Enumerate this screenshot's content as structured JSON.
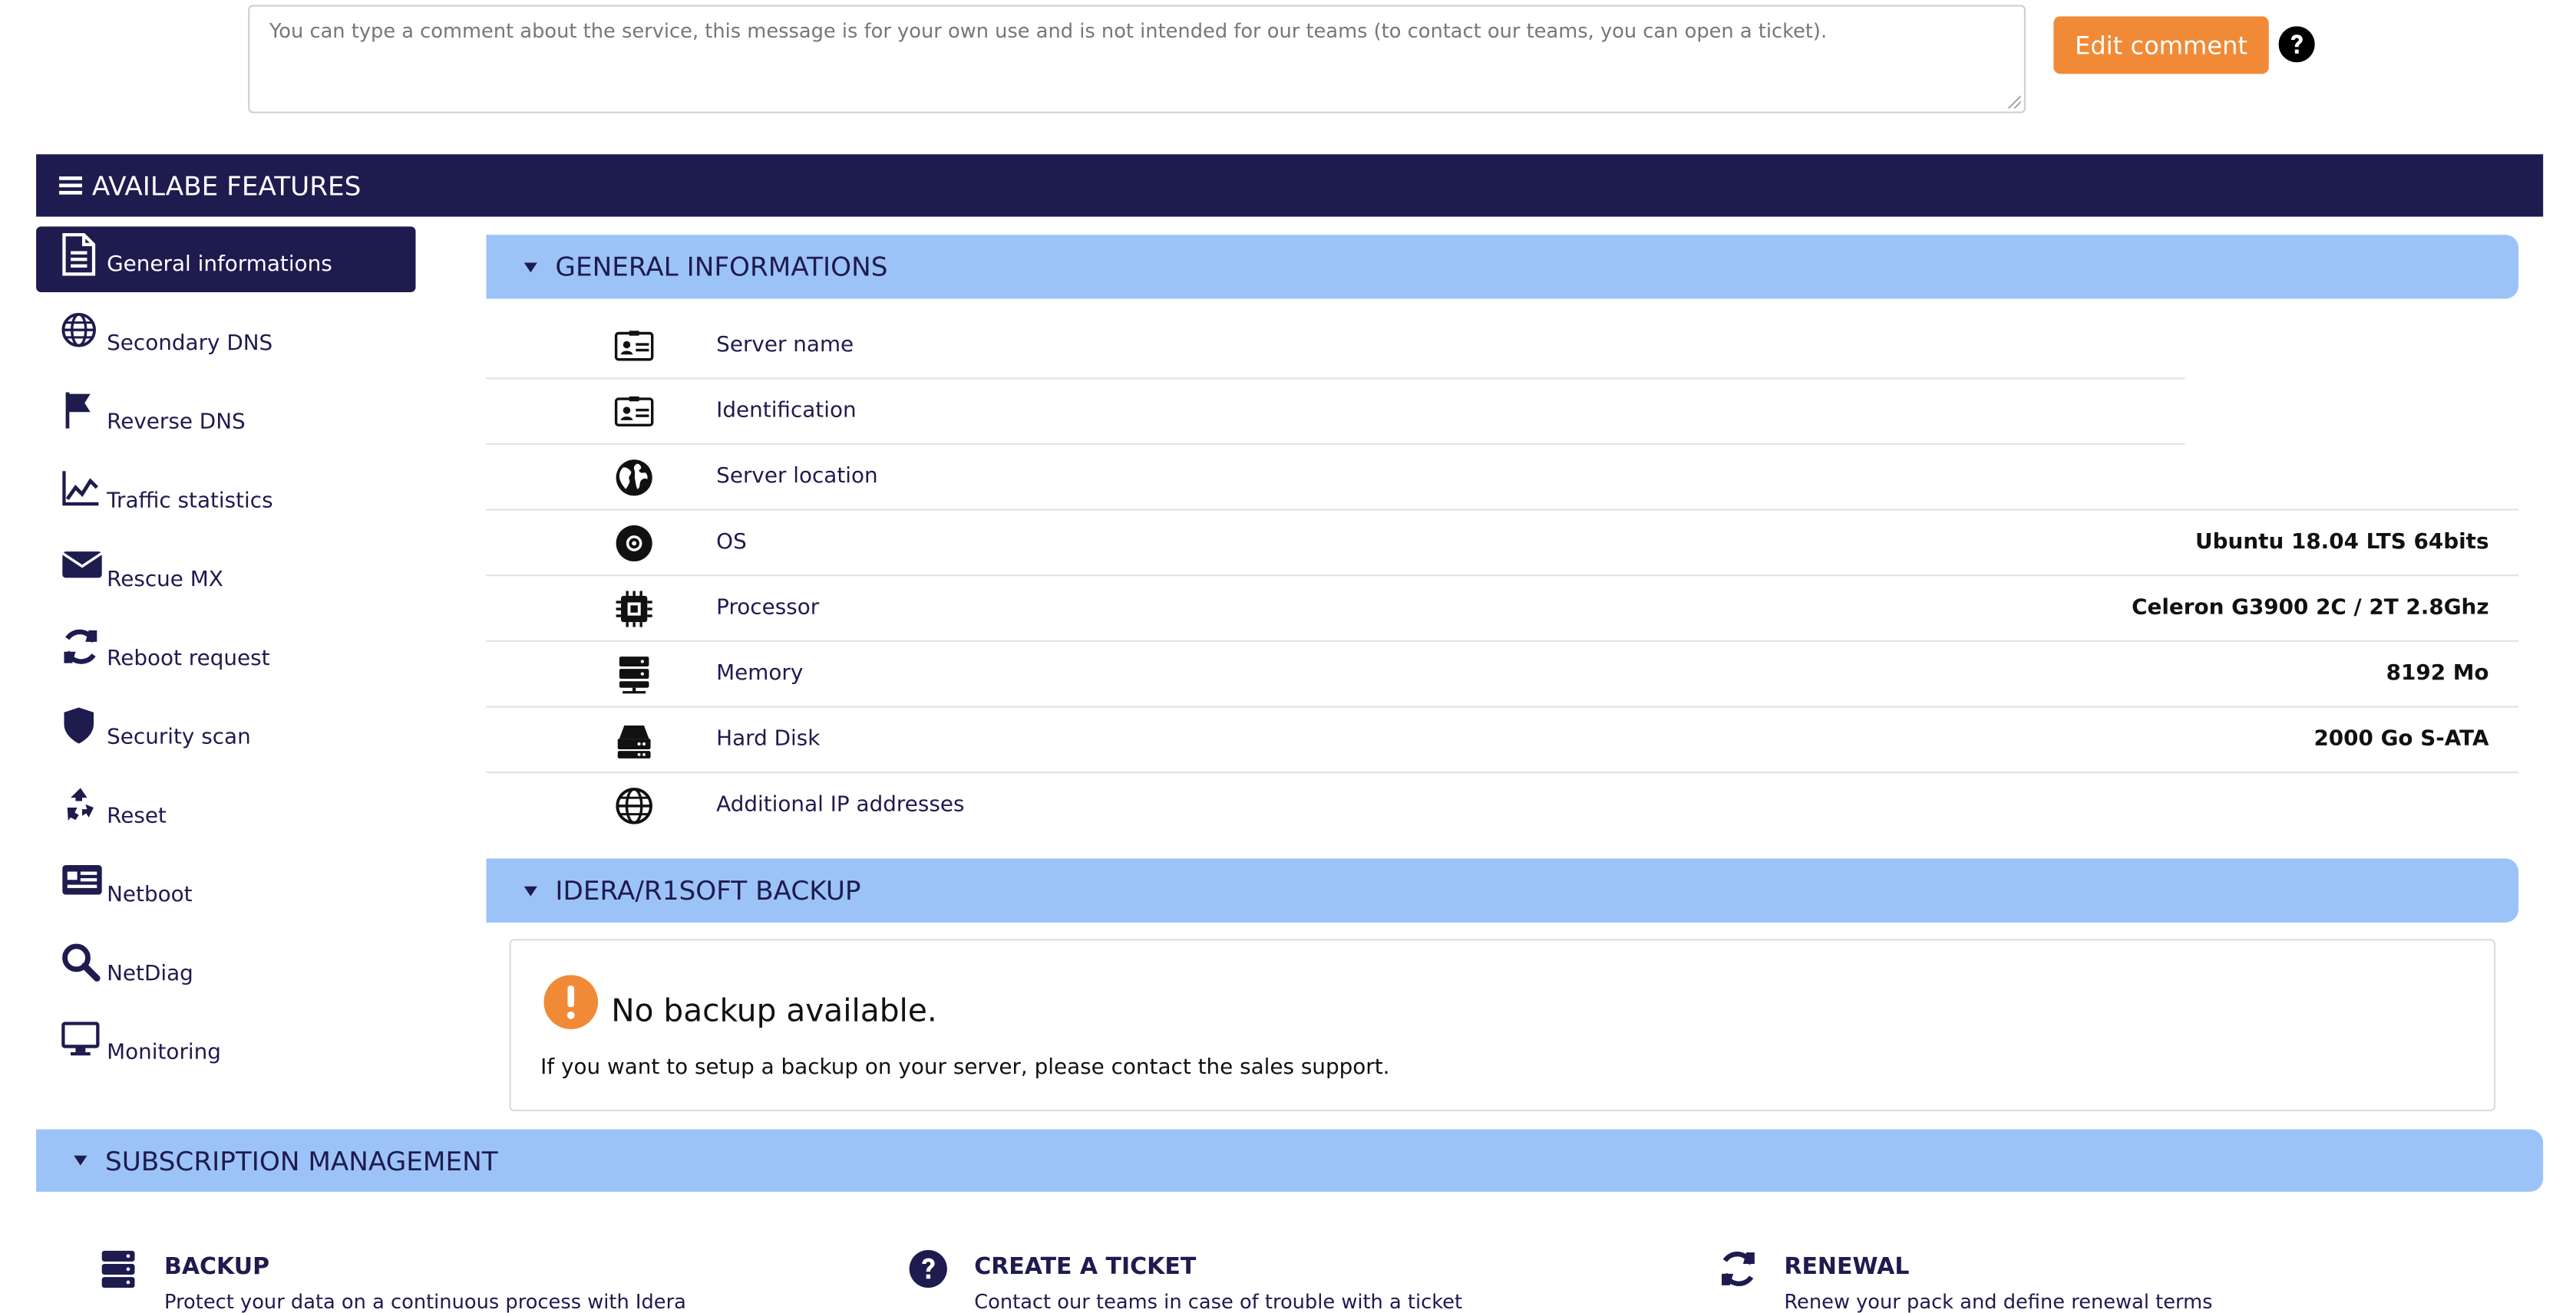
{
  "comment": {
    "placeholder": "You can type a comment about the service, this message is for your own use and is not intended for our teams (to contact our teams, you can open a ticket).",
    "edit_button": "Edit comment",
    "help_icon": "question-circle-icon"
  },
  "features": {
    "title": "AVAILABE FEATURES",
    "icon": "menu-icon"
  },
  "sidebar": {
    "items": [
      {
        "label": "General informations",
        "icon": "document-icon",
        "active": true
      },
      {
        "label": "Secondary DNS",
        "icon": "globe-icon"
      },
      {
        "label": "Reverse DNS",
        "icon": "flag-icon"
      },
      {
        "label": "Traffic statistics",
        "icon": "area-chart-icon"
      },
      {
        "label": "Rescue MX",
        "icon": "envelope-icon"
      },
      {
        "label": "Reboot request",
        "icon": "refresh-icon"
      },
      {
        "label": "Security scan",
        "icon": "shield-icon"
      },
      {
        "label": "Reset",
        "icon": "recycle-icon"
      },
      {
        "label": "Netboot",
        "icon": "id-card-icon"
      },
      {
        "label": "NetDiag",
        "icon": "search-icon"
      },
      {
        "label": "Monitoring",
        "icon": "monitor-icon"
      }
    ]
  },
  "general": {
    "title": "GENERAL INFORMATIONS",
    "rows": [
      {
        "label": "Server name",
        "value": "",
        "icon": "id-card-icon"
      },
      {
        "label": "Identification",
        "value": "",
        "icon": "id-card-icon"
      },
      {
        "label": "Server location",
        "value": "",
        "icon": "earth-icon"
      },
      {
        "label": "OS",
        "value": "Ubuntu 18.04 LTS 64bits",
        "icon": "disc-icon"
      },
      {
        "label": "Processor",
        "value": "Celeron G3900 2C / 2T 2.8Ghz",
        "icon": "chip-icon"
      },
      {
        "label": "Memory",
        "value": "8192 Mo",
        "icon": "server-icon"
      },
      {
        "label": "Hard Disk",
        "value": "2000 Go S-ATA",
        "icon": "hdd-icon"
      },
      {
        "label": "Additional IP addresses",
        "value": "",
        "icon": "globe-icon"
      }
    ]
  },
  "backup": {
    "title": "IDERA/R1SOFT BACKUP",
    "message": "No backup available.",
    "detail": "If you want to setup a backup on your server, please contact the sales support.",
    "icon": "exclamation-circle-icon"
  },
  "subscription": {
    "title": "SUBSCRIPTION MANAGEMENT",
    "tiles": [
      {
        "title": "BACKUP",
        "desc": "Protect your data on a continuous process with Idera",
        "icon": "server-icon"
      },
      {
        "title": "CREATE A TICKET",
        "desc": "Contact our teams in case of trouble with a ticket",
        "icon": "question-circle-icon"
      },
      {
        "title": "RENEWAL",
        "desc": "Renew your pack and define renewal terms",
        "icon": "refresh-icon"
      }
    ]
  },
  "colors": {
    "navy": "#1e1b4f",
    "light_blue": "#9cc3f7",
    "orange": "#f18a36"
  }
}
